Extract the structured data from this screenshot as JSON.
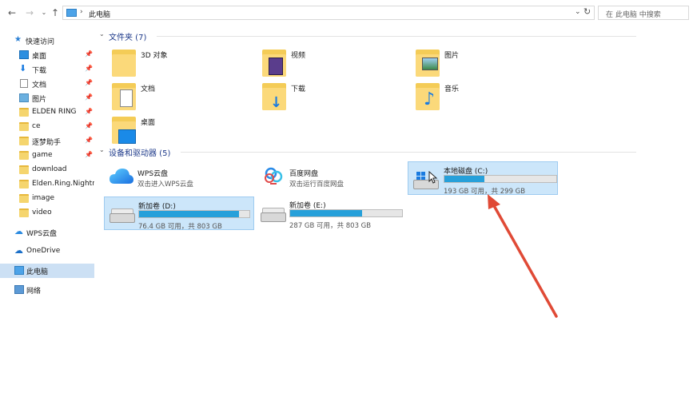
{
  "address_bar": {
    "path": "此电脑",
    "search_placeholder": "在 此电脑 中搜索",
    "back_icon": "back-arrow-icon",
    "forward_icon": "forward-arrow-icon",
    "history_icon": "chevron-down-icon",
    "up_icon": "up-arrow-icon",
    "refresh_icon": "refresh-icon"
  },
  "sidebar": {
    "quick_access": "快速访问",
    "items": [
      {
        "label": "桌面",
        "pinned": true,
        "icon": "desktop-icon"
      },
      {
        "label": "下载",
        "pinned": true,
        "icon": "download-icon"
      },
      {
        "label": "文档",
        "pinned": true,
        "icon": "document-icon"
      },
      {
        "label": "图片",
        "pinned": true,
        "icon": "picture-icon"
      },
      {
        "label": "ELDEN RING",
        "pinned": true,
        "icon": "folder-icon"
      },
      {
        "label": "ce",
        "pinned": true,
        "icon": "folder-icon"
      },
      {
        "label": "逐梦助手",
        "pinned": true,
        "icon": "folder-icon"
      },
      {
        "label": "game",
        "pinned": true,
        "icon": "folder-icon"
      },
      {
        "label": "download",
        "pinned": false,
        "icon": "folder-icon"
      },
      {
        "label": "Elden.Ring.Nightre",
        "pinned": false,
        "icon": "folder-icon"
      },
      {
        "label": "image",
        "pinned": false,
        "icon": "folder-icon"
      },
      {
        "label": "video",
        "pinned": false,
        "icon": "folder-icon"
      }
    ],
    "wps": "WPS云盘",
    "onedrive": "OneDrive",
    "this_pc": "此电脑",
    "network": "网络"
  },
  "folders_group": {
    "title": "文件夹 (7)",
    "items": [
      {
        "label": "3D 对象",
        "icon": "3d-objects-folder-icon"
      },
      {
        "label": "视频",
        "icon": "videos-folder-icon"
      },
      {
        "label": "图片",
        "icon": "pictures-folder-icon"
      },
      {
        "label": "文档",
        "icon": "documents-folder-icon"
      },
      {
        "label": "下载",
        "icon": "downloads-folder-icon"
      },
      {
        "label": "音乐",
        "icon": "music-folder-icon"
      },
      {
        "label": "桌面",
        "icon": "desktop-folder-icon"
      }
    ]
  },
  "devices_group": {
    "title": "设备和驱动器 (5)",
    "wps": {
      "name": "WPS云盘",
      "desc": "双击进入WPS云盘",
      "icon": "wps-cloud-icon"
    },
    "baidu": {
      "name": "百度网盘",
      "desc": "双击运行百度网盘",
      "icon": "baidu-netdisk-icon"
    },
    "drives": [
      {
        "name": "本地磁盘 (C:)",
        "free": "193 GB 可用，共 299 GB",
        "used_fraction": 0.355,
        "selected": true,
        "icon": "windows-drive-icon"
      },
      {
        "name": "新加卷 (D:)",
        "free": "76.4 GB 可用，共 803 GB",
        "used_fraction": 0.905,
        "selected": true,
        "icon": "hard-drive-icon"
      },
      {
        "name": "新加卷 (E:)",
        "free": "287 GB 可用，共 803 GB",
        "used_fraction": 0.643,
        "selected": false,
        "icon": "hard-drive-icon"
      }
    ]
  },
  "colors": {
    "accent": "#26a0da",
    "selection": "#cce6fa",
    "group_title": "#1e3a8a",
    "annotation_arrow": "#e04a36"
  }
}
